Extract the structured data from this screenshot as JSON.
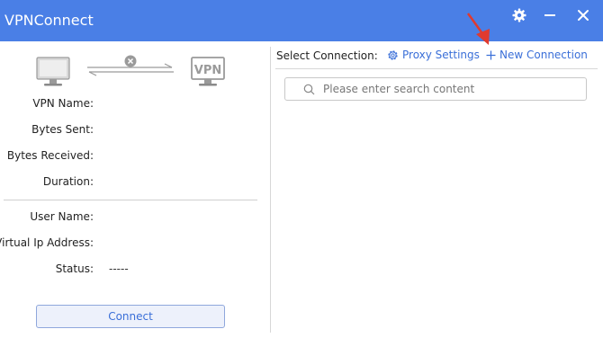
{
  "window": {
    "title": "VPNConnect",
    "accent_color": "#4a7fe6",
    "controls": [
      "gear-icon",
      "minimize-icon",
      "close-icon"
    ]
  },
  "connection_status": {
    "local_icon": "computer-icon",
    "remote_icon": "vpn-server-icon",
    "link_state_icon": "disconnected-x-icon",
    "fields": [
      {
        "label": "VPN Name:",
        "value": ""
      },
      {
        "label": "Bytes Sent:",
        "value": ""
      },
      {
        "label": "Bytes Received:",
        "value": ""
      },
      {
        "label": "Duration:",
        "value": ""
      }
    ],
    "user_fields": [
      {
        "label": "User Name:",
        "value": ""
      },
      {
        "label": "Virtual Ip Address:",
        "value": ""
      },
      {
        "label": "Status:",
        "value": "-----"
      }
    ],
    "connect_label": "Connect"
  },
  "connections": {
    "select_label": "Select Connection:",
    "proxy_settings_label": "Proxy Settings",
    "new_connection_label": "New Connection",
    "search_placeholder": "Please enter search content",
    "link_color": "#3a6fd8"
  },
  "annotation": {
    "arrow_color": "#e03a2f"
  }
}
